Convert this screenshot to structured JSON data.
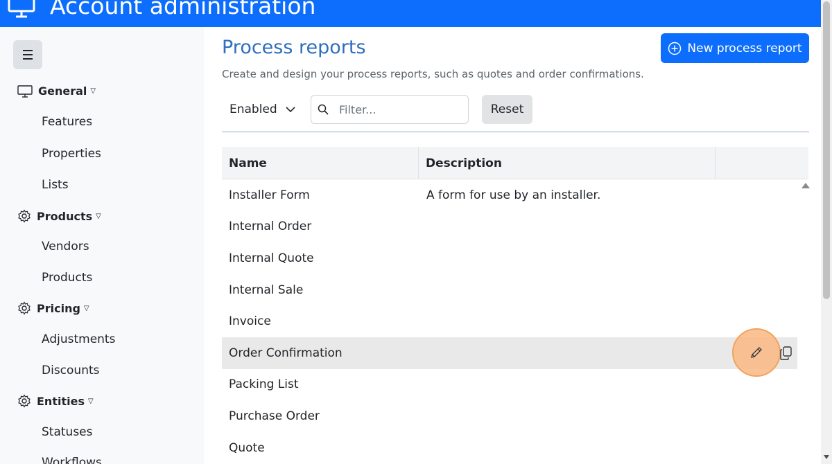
{
  "header": {
    "title": "Account administration",
    "icon": "monitor-icon"
  },
  "sidebar": {
    "sections": [
      {
        "label": "General",
        "icon": "monitor-icon",
        "items": [
          "Features",
          "Properties",
          "Lists"
        ]
      },
      {
        "label": "Products",
        "icon": "gear-icon",
        "items": [
          "Vendors",
          "Products"
        ]
      },
      {
        "label": "Pricing",
        "icon": "gear-icon",
        "items": [
          "Adjustments",
          "Discounts"
        ]
      },
      {
        "label": "Entities",
        "icon": "gear-icon",
        "items": [
          "Statuses",
          "Workflows"
        ]
      }
    ]
  },
  "main": {
    "title": "Process reports",
    "subtitle": "Create and design your process reports, such as quotes and order confirmations.",
    "new_button": "New process report",
    "status_filter": "Enabled",
    "filter_placeholder": "Filter...",
    "reset_button": "Reset",
    "table": {
      "columns": [
        "Name",
        "Description",
        ""
      ],
      "rows": [
        {
          "name": "Installer Form",
          "description": "A form for use by an installer."
        },
        {
          "name": "Internal Order",
          "description": ""
        },
        {
          "name": "Internal Quote",
          "description": ""
        },
        {
          "name": "Internal Sale",
          "description": ""
        },
        {
          "name": "Invoice",
          "description": ""
        },
        {
          "name": "Order Confirmation",
          "description": ""
        },
        {
          "name": "Packing List",
          "description": ""
        },
        {
          "name": "Purchase Order",
          "description": ""
        },
        {
          "name": "Quote",
          "description": ""
        }
      ],
      "highlighted_row": "Order Confirmation"
    }
  },
  "colors": {
    "primary": "#0d6efd",
    "title": "#2f6ebe",
    "highlight": "#e9e9e9",
    "cursor_ring": "#f0a35e"
  }
}
